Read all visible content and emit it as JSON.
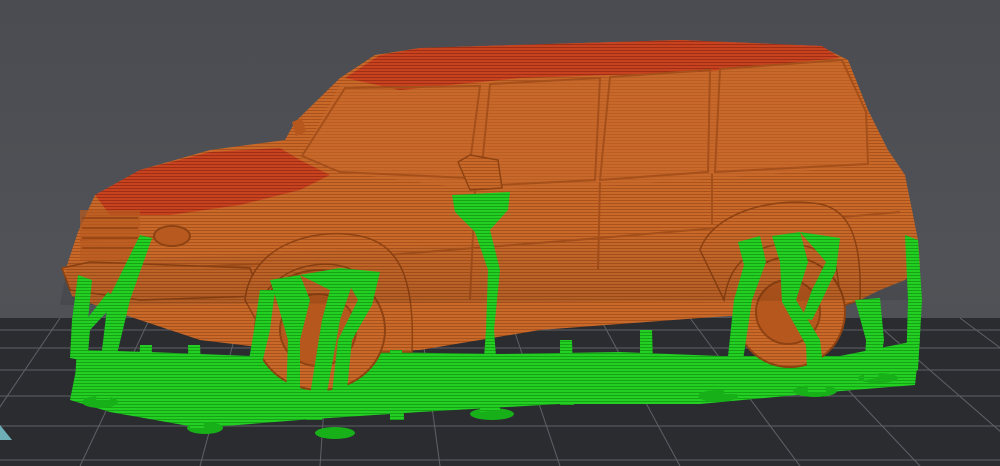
{
  "scene": {
    "background": "#4d4f54",
    "bed_color": "#2a2b2f",
    "bed_grid_color": "#5e6066",
    "model_color": "#c8692a",
    "model_top_color": "#c23a1e",
    "support_color": "#1ecb1e",
    "support_dark_color": "#139a13"
  },
  "objects": [
    {
      "name": "build-plate"
    },
    {
      "name": "sliced-suv-model"
    },
    {
      "name": "tree-supports"
    }
  ]
}
